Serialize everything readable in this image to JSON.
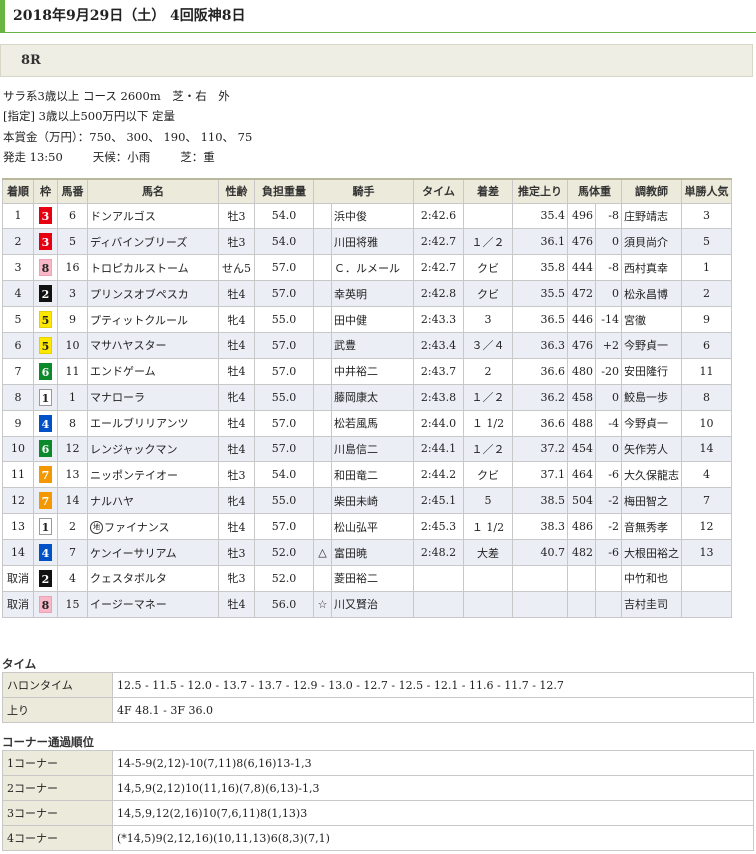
{
  "header": {
    "date": "2018年9月29日（土） 4回阪神8日",
    "race_number": "8R"
  },
  "race_info": {
    "line1": "サラ系3歳以上 コース 2600m　芝・右　外",
    "line2": "[指定] 3歳以上500万円以下 定量",
    "line3": "本賞金（万円）：750、 300、 190、 110、 75",
    "line4_start": "発走 13:50",
    "line4_weather": "天候：小雨",
    "line4_track": "芝：重"
  },
  "columns": [
    "着順",
    "枠",
    "馬番",
    "馬名",
    "性齢",
    "負担重量",
    "騎手",
    "タイム",
    "着差",
    "推定上り",
    "馬体重",
    "",
    "調教師",
    "単勝人気"
  ],
  "frame_colors": {
    "1": {
      "bg": "#ffffff",
      "fg": "#222222",
      "border": "#999999"
    },
    "2": {
      "bg": "#111111",
      "fg": "#ffffff",
      "border": "#111111"
    },
    "3": {
      "bg": "#e60012",
      "fg": "#ffffff",
      "border": "#e60012"
    },
    "4": {
      "bg": "#0050c8",
      "fg": "#ffffff",
      "border": "#0050c8"
    },
    "5": {
      "bg": "#ffe800",
      "fg": "#222222",
      "border": "#e6d000"
    },
    "6": {
      "bg": "#0a8a2a",
      "fg": "#ffffff",
      "border": "#0a8a2a"
    },
    "7": {
      "bg": "#f39800",
      "fg": "#ffffff",
      "border": "#f39800"
    },
    "8": {
      "bg": "#f8b8c8",
      "fg": "#222222",
      "border": "#f0a0b4"
    }
  },
  "rows": [
    {
      "rank": "1",
      "frame": "3",
      "num": "6",
      "name": "ドンアルゴス",
      "local": "",
      "sex_age": "牡3",
      "weight": "54.0",
      "mark": "",
      "jockey": "浜中俊",
      "time": "2:42.6",
      "margin": "",
      "last3f": "35.4",
      "body": "496",
      "diff": "-8",
      "trainer": "庄野靖志",
      "pop": "3"
    },
    {
      "rank": "2",
      "frame": "3",
      "num": "5",
      "name": "ディバインブリーズ",
      "local": "",
      "sex_age": "牡3",
      "weight": "54.0",
      "mark": "",
      "jockey": "川田将雅",
      "time": "2:42.7",
      "margin": "１／２",
      "last3f": "36.1",
      "body": "476",
      "diff": "0",
      "trainer": "須貝尚介",
      "pop": "5"
    },
    {
      "rank": "3",
      "frame": "8",
      "num": "16",
      "name": "トロピカルストーム",
      "local": "",
      "sex_age": "せん5",
      "weight": "57.0",
      "mark": "",
      "jockey": "Ｃ．ルメール",
      "time": "2:42.7",
      "margin": "クビ",
      "last3f": "35.8",
      "body": "444",
      "diff": "-8",
      "trainer": "西村真幸",
      "pop": "1"
    },
    {
      "rank": "4",
      "frame": "2",
      "num": "3",
      "name": "プリンスオブペスカ",
      "local": "",
      "sex_age": "牡4",
      "weight": "57.0",
      "mark": "",
      "jockey": "幸英明",
      "time": "2:42.8",
      "margin": "クビ",
      "last3f": "35.5",
      "body": "472",
      "diff": "0",
      "trainer": "松永昌博",
      "pop": "2"
    },
    {
      "rank": "5",
      "frame": "5",
      "num": "9",
      "name": "プティットクルール",
      "local": "",
      "sex_age": "牝4",
      "weight": "55.0",
      "mark": "",
      "jockey": "田中健",
      "time": "2:43.3",
      "margin": "3",
      "last3f": "36.5",
      "body": "446",
      "diff": "-14",
      "trainer": "宮徹",
      "pop": "9"
    },
    {
      "rank": "6",
      "frame": "5",
      "num": "10",
      "name": "マサハヤスター",
      "local": "",
      "sex_age": "牡4",
      "weight": "57.0",
      "mark": "",
      "jockey": "武豊",
      "time": "2:43.4",
      "margin": "３／４",
      "last3f": "36.3",
      "body": "476",
      "diff": "+2",
      "trainer": "今野貞一",
      "pop": "6"
    },
    {
      "rank": "7",
      "frame": "6",
      "num": "11",
      "name": "エンドゲーム",
      "local": "",
      "sex_age": "牡4",
      "weight": "57.0",
      "mark": "",
      "jockey": "中井裕二",
      "time": "2:43.7",
      "margin": "2",
      "last3f": "36.6",
      "body": "480",
      "diff": "-20",
      "trainer": "安田隆行",
      "pop": "11"
    },
    {
      "rank": "8",
      "frame": "1",
      "num": "1",
      "name": "マナローラ",
      "local": "",
      "sex_age": "牝4",
      "weight": "55.0",
      "mark": "",
      "jockey": "藤岡康太",
      "time": "2:43.8",
      "margin": "１／２",
      "last3f": "36.2",
      "body": "458",
      "diff": "0",
      "trainer": "鮫島一歩",
      "pop": "8"
    },
    {
      "rank": "9",
      "frame": "4",
      "num": "8",
      "name": "エールブリリアンツ",
      "local": "",
      "sex_age": "牡4",
      "weight": "57.0",
      "mark": "",
      "jockey": "松若風馬",
      "time": "2:44.0",
      "margin": "１ 1/2",
      "last3f": "36.6",
      "body": "488",
      "diff": "-4",
      "trainer": "今野貞一",
      "pop": "10"
    },
    {
      "rank": "10",
      "frame": "6",
      "num": "12",
      "name": "レンジャックマン",
      "local": "",
      "sex_age": "牡4",
      "weight": "57.0",
      "mark": "",
      "jockey": "川島信二",
      "time": "2:44.1",
      "margin": "１／２",
      "last3f": "37.2",
      "body": "454",
      "diff": "0",
      "trainer": "矢作芳人",
      "pop": "14"
    },
    {
      "rank": "11",
      "frame": "7",
      "num": "13",
      "name": "ニッポンテイオー",
      "local": "",
      "sex_age": "牡3",
      "weight": "54.0",
      "mark": "",
      "jockey": "和田竜二",
      "time": "2:44.2",
      "margin": "クビ",
      "last3f": "37.1",
      "body": "464",
      "diff": "-6",
      "trainer": "大久保龍志",
      "pop": "4"
    },
    {
      "rank": "12",
      "frame": "7",
      "num": "14",
      "name": "ナルハヤ",
      "local": "",
      "sex_age": "牝4",
      "weight": "55.0",
      "mark": "",
      "jockey": "柴田未崎",
      "time": "2:45.1",
      "margin": "5",
      "last3f": "38.5",
      "body": "504",
      "diff": "-2",
      "trainer": "梅田智之",
      "pop": "7"
    },
    {
      "rank": "13",
      "frame": "1",
      "num": "2",
      "name": "ファイナンス",
      "local": "地",
      "sex_age": "牡4",
      "weight": "57.0",
      "mark": "",
      "jockey": "松山弘平",
      "time": "2:45.3",
      "margin": "１ 1/2",
      "last3f": "38.3",
      "body": "486",
      "diff": "-2",
      "trainer": "音無秀孝",
      "pop": "12"
    },
    {
      "rank": "14",
      "frame": "4",
      "num": "7",
      "name": "ケンイーサリアム",
      "local": "",
      "sex_age": "牡3",
      "weight": "52.0",
      "mark": "△",
      "jockey": "富田暁",
      "time": "2:48.2",
      "margin": "大差",
      "last3f": "40.7",
      "body": "482",
      "diff": "-6",
      "trainer": "大根田裕之",
      "pop": "13"
    },
    {
      "rank": "取消",
      "frame": "2",
      "num": "4",
      "name": "クェスタボルタ",
      "local": "",
      "sex_age": "牝3",
      "weight": "52.0",
      "mark": "",
      "jockey": "菱田裕二",
      "time": "",
      "margin": "",
      "last3f": "",
      "body": "",
      "diff": "",
      "trainer": "中竹和也",
      "pop": ""
    },
    {
      "rank": "取消",
      "frame": "8",
      "num": "15",
      "name": "イージーマネー",
      "local": "",
      "sex_age": "牡4",
      "weight": "56.0",
      "mark": "☆",
      "jockey": "川又賢治",
      "time": "",
      "margin": "",
      "last3f": "",
      "body": "",
      "diff": "",
      "trainer": "吉村圭司",
      "pop": ""
    }
  ],
  "time_section": {
    "title": "タイム",
    "rows": [
      {
        "label": "ハロンタイム",
        "value": "12.5 - 11.5 - 12.0 - 13.7 - 13.7 - 12.9 - 13.0 - 12.7 - 12.5 - 12.1 - 11.6 - 11.7 - 12.7"
      },
      {
        "label": "上り",
        "value": "4F 48.1 - 3F 36.0"
      }
    ]
  },
  "corner_section": {
    "title": "コーナー通過順位",
    "rows": [
      {
        "label": "1コーナー",
        "value": "14-5-9(2,12)-10(7,11)8(6,16)13-1,3"
      },
      {
        "label": "2コーナー",
        "value": "14,5,9(2,12)10(11,16)(7,8)(6,13)-1,3"
      },
      {
        "label": "3コーナー",
        "value": "14,5,9,12(2,16)10(7,6,11)8(1,13)3"
      },
      {
        "label": "4コーナー",
        "value": "(*14,5)9(2,12,16)(10,11,13)6(8,3)(7,1)"
      }
    ]
  }
}
